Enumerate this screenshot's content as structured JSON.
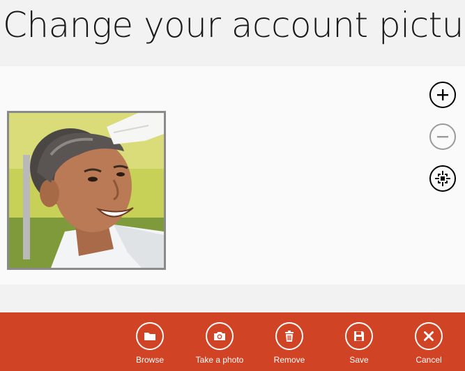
{
  "page": {
    "title": "Change your account picture"
  },
  "colors": {
    "appbar_background": "#d04324",
    "page_background": "#f2f2f2",
    "canvas_background": "#fafafa",
    "frame_border": "#8a8a8a"
  },
  "picture": {
    "icon": "account-photo"
  },
  "zoom_controls": [
    {
      "name": "zoom-in-button",
      "icon": "plus-icon",
      "enabled": true
    },
    {
      "name": "zoom-out-button",
      "icon": "minus-icon",
      "enabled": false
    },
    {
      "name": "crop-fit-button",
      "icon": "crop-target-icon",
      "enabled": true
    }
  ],
  "appbar": {
    "buttons": [
      {
        "name": "browse-button",
        "label": "Browse",
        "icon": "folder-icon"
      },
      {
        "name": "take-photo-button",
        "label": "Take a photo",
        "icon": "camera-icon"
      },
      {
        "name": "remove-button",
        "label": "Remove",
        "icon": "trash-icon"
      },
      {
        "name": "save-button",
        "label": "Save",
        "icon": "save-icon"
      },
      {
        "name": "cancel-button",
        "label": "Cancel",
        "icon": "close-icon"
      }
    ]
  }
}
